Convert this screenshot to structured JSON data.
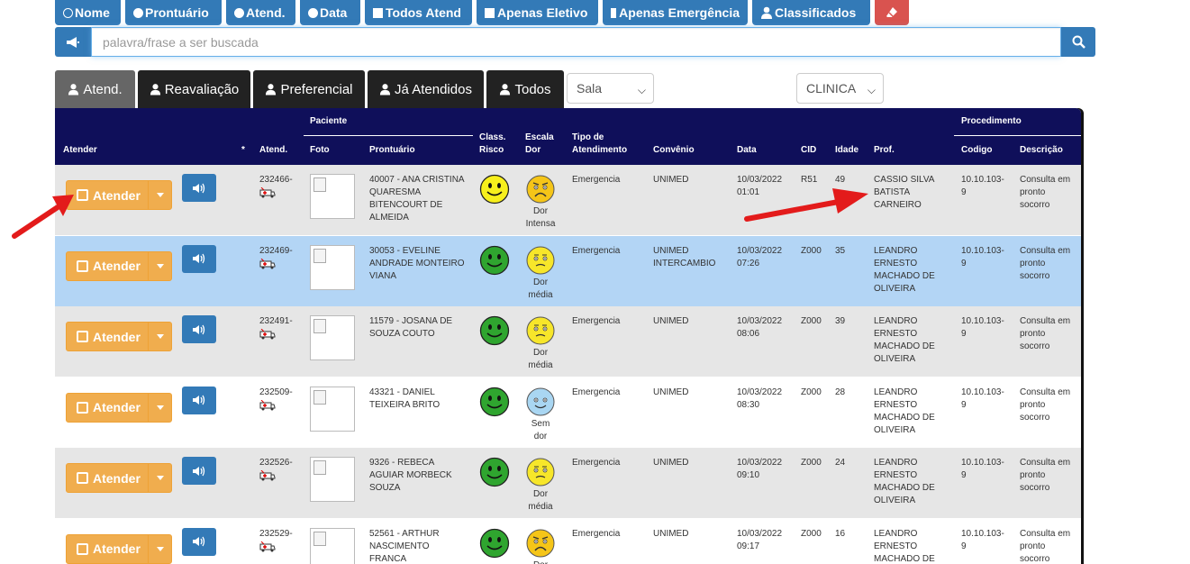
{
  "filters": [
    {
      "label": "Nome",
      "type": "radio",
      "checked": false,
      "icon": "radio-empty-icon"
    },
    {
      "label": "Prontuário",
      "type": "radio",
      "checked": true,
      "icon": "radio-filled-icon"
    },
    {
      "label": "Atend.",
      "type": "radio",
      "checked": true,
      "icon": "radio-filled-icon"
    },
    {
      "label": "Data",
      "type": "radio",
      "checked": true,
      "icon": "radio-filled-icon"
    },
    {
      "label": "Todos Atend",
      "type": "checkbox",
      "icon": "checkbox-icon"
    },
    {
      "label": "Apenas Eletivo",
      "type": "checkbox",
      "icon": "checkbox-icon"
    },
    {
      "label": "Apenas Emergência",
      "type": "checkbox",
      "icon": "checkbox-icon"
    },
    {
      "label": "Classificados",
      "type": "user",
      "icon": "user-icon"
    }
  ],
  "search": {
    "placeholder": "palavra/frase a ser buscada"
  },
  "tabs": [
    {
      "label": "Atend.",
      "active": true
    },
    {
      "label": "Reavaliação",
      "active": false
    },
    {
      "label": "Preferencial",
      "active": false
    },
    {
      "label": "Já Atendidos",
      "active": false
    },
    {
      "label": "Todos",
      "active": false
    }
  ],
  "selects": {
    "sala": "Sala",
    "clinica": "CLINICA"
  },
  "table": {
    "headers": {
      "atender": "Atender",
      "star": "*",
      "atend": "Atend.",
      "paciente": "Paciente",
      "foto": "Foto",
      "prontuario": "Prontuário",
      "class_risco_1": "Class.",
      "class_risco_2": "Risco",
      "escala_dor_1": "Escala",
      "escala_dor_2": "Dor",
      "tipo_1": "Tipo de",
      "tipo_2": "Atendimento",
      "convenio": "Convênio",
      "data": "Data",
      "cid": "CID",
      "idade": "Idade",
      "prof": "Prof.",
      "procedimento": "Procedimento",
      "codigo": "Codigo",
      "descricao": "Descrição"
    },
    "button_label": "Atender",
    "rows": [
      {
        "bg": "gray",
        "atend": "232466-",
        "pront": [
          "40007 - ANA CRISTINA",
          "QUARESMA",
          "BITENCOURT DE",
          "ALMEIDA"
        ],
        "risk": "yellow",
        "pain": "intense",
        "pain_lbl": [
          "Dor",
          "Intensa"
        ],
        "tipo": "Emergencia",
        "conv": [
          "UNIMED"
        ],
        "data": [
          "10/03/2022",
          "01:01"
        ],
        "cid": "R51",
        "idade": "49",
        "prof": [
          "CASSIO SILVA",
          "BATISTA",
          "CARNEIRO"
        ],
        "cod": [
          "10.10.103-",
          "9"
        ],
        "desc": [
          "Consulta em",
          "pronto",
          "socorro"
        ]
      },
      {
        "bg": "blue",
        "atend": "232469-",
        "pront": [
          "30053 - EVELINE",
          "ANDRADE MONTEIRO",
          "VIANA"
        ],
        "risk": "green",
        "pain": "medium",
        "pain_lbl": [
          "Dor",
          "média"
        ],
        "tipo": "Emergencia",
        "conv": [
          "UNIMED",
          "INTERCAMBIO"
        ],
        "data": [
          "10/03/2022",
          "07:26"
        ],
        "cid": "Z000",
        "idade": "35",
        "prof": [
          "LEANDRO",
          "ERNESTO",
          "MACHADO DE",
          "OLIVEIRA"
        ],
        "cod": [
          "10.10.103-",
          "9"
        ],
        "desc": [
          "Consulta em",
          "pronto",
          "socorro"
        ]
      },
      {
        "bg": "gray",
        "atend": "232491-",
        "pront": [
          "11579 - JOSANA DE",
          "SOUZA COUTO"
        ],
        "risk": "green",
        "pain": "medium",
        "pain_lbl": [
          "Dor",
          "média"
        ],
        "tipo": "Emergencia",
        "conv": [
          "UNIMED"
        ],
        "data": [
          "10/03/2022",
          "08:06"
        ],
        "cid": "Z000",
        "idade": "39",
        "prof": [
          "LEANDRO",
          "ERNESTO",
          "MACHADO DE",
          "OLIVEIRA"
        ],
        "cod": [
          "10.10.103-",
          "9"
        ],
        "desc": [
          "Consulta em",
          "pronto",
          "socorro"
        ]
      },
      {
        "bg": "white",
        "atend": "232509-",
        "pront": [
          "43321 - DANIEL",
          "TEIXEIRA BRITO"
        ],
        "risk": "green",
        "pain": "none",
        "pain_lbl": [
          "Sem",
          "dor"
        ],
        "tipo": "Emergencia",
        "conv": [
          "UNIMED"
        ],
        "data": [
          "10/03/2022",
          "08:30"
        ],
        "cid": "Z000",
        "idade": "28",
        "prof": [
          "LEANDRO",
          "ERNESTO",
          "MACHADO DE",
          "OLIVEIRA"
        ],
        "cod": [
          "10.10.103-",
          "9"
        ],
        "desc": [
          "Consulta em",
          "pronto",
          "socorro"
        ]
      },
      {
        "bg": "gray",
        "atend": "232526-",
        "pront": [
          "9326 - REBECA",
          "AGUIAR MORBECK",
          "SOUZA"
        ],
        "risk": "green",
        "pain": "medium",
        "pain_lbl": [
          "Dor",
          "média"
        ],
        "tipo": "Emergencia",
        "conv": [
          "UNIMED"
        ],
        "data": [
          "10/03/2022",
          "09:10"
        ],
        "cid": "Z000",
        "idade": "24",
        "prof": [
          "LEANDRO",
          "ERNESTO",
          "MACHADO DE",
          "OLIVEIRA"
        ],
        "cod": [
          "10.10.103-",
          "9"
        ],
        "desc": [
          "Consulta em",
          "pronto",
          "socorro"
        ]
      },
      {
        "bg": "white",
        "atend": "232529-",
        "pront": [
          "52561 - ARTHUR",
          "NASCIMENTO",
          "FRANCA"
        ],
        "risk": "green",
        "pain": "intense",
        "pain_lbl": [
          "Dor",
          ""
        ],
        "tipo": "Emergencia",
        "conv": [
          "UNIMED"
        ],
        "data": [
          "10/03/2022",
          "09:17"
        ],
        "cid": "Z000",
        "idade": "16",
        "prof": [
          "LEANDRO",
          "ERNESTO",
          "MACHADO DE"
        ],
        "cod": [
          "10.10.103-",
          "9"
        ],
        "desc": [
          "Consulta em",
          "pronto",
          "socorro"
        ]
      }
    ]
  },
  "colors": {
    "primary": "#337ab7",
    "warning": "#f0ad4e",
    "danger": "#d9534f",
    "header": "#0f0f5a",
    "arrow": "#e31b1b"
  }
}
